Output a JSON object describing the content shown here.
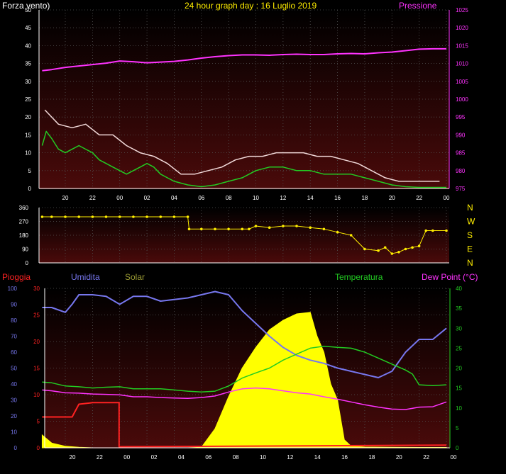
{
  "title": "24 hour graph day : 16 Luglio 2019",
  "colors": {
    "wind": "#ffffff",
    "gust": "#f0d8d8",
    "avg_wind": "#22cc22",
    "pressure": "#ff33ff",
    "direction": "#ffee00",
    "rain": "#ff2222",
    "humidity": "#7777ee",
    "solar": "#ffff00",
    "temperature": "#22cc22",
    "dewpoint": "#ff33ff",
    "axis": "#ffffff",
    "grid": "#555555"
  },
  "x_ticks": [
    "20",
    "22",
    "00",
    "02",
    "04",
    "06",
    "08",
    "10",
    "12",
    "14",
    "16",
    "18",
    "20",
    "22",
    "00"
  ],
  "chart_data": [
    {
      "type": "line",
      "title": "24 hour graph day : 16 Luglio 2019",
      "left_label": "Forza vento)",
      "right_label": "Pressione",
      "left_ticks": [
        "50",
        "45",
        "40",
        "35",
        "30",
        "25",
        "20",
        "15",
        "10",
        "5",
        "0"
      ],
      "right_ticks": [
        "1025",
        "1020",
        "1015",
        "1010",
        "1005",
        "1000",
        "995",
        "990",
        "985",
        "980",
        "975"
      ],
      "ylim": [
        0,
        50
      ],
      "ylim_right": [
        975,
        1025
      ],
      "series": [
        {
          "key": "wind",
          "x": [
            18.5,
            19.5,
            20.5,
            21.5,
            22.5,
            23.5,
            0.5,
            1.5,
            2.5,
            3.5,
            4.5,
            5.5,
            6.5,
            7.5,
            8.5,
            9.5,
            10.5,
            11.5,
            12.5,
            13.5,
            14.5,
            15.5,
            16.5,
            17.5,
            18.5,
            19.5,
            20.5,
            21.5,
            22.5,
            23.5
          ],
          "values": [
            22,
            18,
            17,
            18,
            15,
            15,
            12,
            10,
            9,
            7,
            4,
            4,
            5,
            6,
            8,
            9,
            9,
            10,
            10,
            10,
            9,
            9,
            8,
            7,
            5,
            3,
            2,
            2,
            2,
            2
          ]
        },
        {
          "key": "avg_wind",
          "x": [
            18.3,
            18.6,
            19.0,
            19.5,
            20.0,
            20.5,
            21.0,
            21.5,
            22.0,
            22.5,
            23.0,
            23.5,
            0.0,
            0.5,
            1.0,
            1.5,
            2.0,
            2.5,
            3.0,
            3.5,
            4.0,
            5.0,
            6.0,
            7.0,
            8.0,
            9.0,
            10.0,
            11.0,
            12.0,
            13.0,
            14.0,
            15.0,
            16.0,
            17.0,
            18.0,
            19.0,
            20.0,
            21.0,
            22.0,
            23.0,
            24.0
          ],
          "values": [
            12,
            16,
            14,
            11,
            10,
            11,
            12,
            11,
            10,
            8,
            7,
            6,
            5,
            4,
            5,
            6,
            7,
            6,
            4,
            3,
            2,
            1,
            0.5,
            1,
            2,
            3,
            5,
            6,
            6,
            5,
            5,
            4,
            4,
            4,
            3,
            2,
            1,
            0.5,
            0.3,
            0.3,
            0.3
          ]
        },
        {
          "key": "pressure",
          "x": [
            18.3,
            19.0,
            20.0,
            21.0,
            22.0,
            23.0,
            0.0,
            1.0,
            2.0,
            3.0,
            4.0,
            5.0,
            6.0,
            7.0,
            8.0,
            9.0,
            10.0,
            11.0,
            12.0,
            13.0,
            14.0,
            15.0,
            16.0,
            17.0,
            18.0,
            19.0,
            20.0,
            21.0,
            22.0,
            23.0,
            24.0
          ],
          "values": [
            1008.0,
            1008.3,
            1008.9,
            1009.3,
            1009.7,
            1010.1,
            1010.7,
            1010.5,
            1010.2,
            1010.4,
            1010.6,
            1011.0,
            1011.5,
            1011.9,
            1012.2,
            1012.4,
            1012.4,
            1012.3,
            1012.5,
            1012.6,
            1012.5,
            1012.5,
            1012.7,
            1012.8,
            1012.7,
            1013.0,
            1013.2,
            1013.6,
            1014.0,
            1014.1,
            1014.1
          ]
        }
      ]
    },
    {
      "type": "scatter",
      "left_ticks": [
        "360",
        "270",
        "180",
        "90",
        "0"
      ],
      "right_ticks": [
        "N",
        "W",
        "S",
        "E",
        "N"
      ],
      "ylim": [
        0,
        360
      ],
      "series": [
        {
          "key": "direction",
          "x": [
            18.3,
            19.0,
            20.0,
            21.0,
            22.0,
            23.0,
            0.0,
            1.0,
            2.0,
            3.0,
            4.0,
            5.0,
            5.1,
            6.0,
            7.0,
            8.0,
            9.0,
            9.5,
            10.0,
            11.0,
            12.0,
            13.0,
            14.0,
            15.0,
            16.0,
            17.0,
            18.0,
            19.0,
            19.5,
            20.0,
            20.5,
            21.0,
            21.5,
            22.0,
            22.5,
            23.0,
            24.0
          ],
          "values": [
            300,
            300,
            300,
            300,
            300,
            300,
            300,
            300,
            300,
            300,
            300,
            300,
            220,
            220,
            220,
            220,
            220,
            220,
            240,
            230,
            240,
            240,
            230,
            220,
            200,
            180,
            90,
            80,
            100,
            60,
            70,
            90,
            100,
            110,
            210,
            210,
            210
          ]
        }
      ]
    },
    {
      "type": "line",
      "labels": [
        "Pioggia",
        "Umidita",
        "Solar",
        "Temperatura",
        "Dew Point (°C)"
      ],
      "left_ticks_rain": [
        "30",
        "25",
        "20",
        "15",
        "10",
        "5",
        "0"
      ],
      "left_ticks_hum": [
        "100",
        "90",
        "80",
        "70",
        "60",
        "50",
        "40",
        "30",
        "20",
        "10",
        "0"
      ],
      "right_ticks": [
        "40",
        "35",
        "30",
        "25",
        "20",
        "15",
        "10",
        "5",
        "0"
      ],
      "ylim_rain": [
        0,
        30
      ],
      "ylim_humidity": [
        0,
        100
      ],
      "ylim_temp": [
        0,
        40
      ],
      "series": [
        {
          "key": "rain",
          "x": [
            18.3,
            19.5,
            20.5,
            21.0,
            22.0,
            23.0,
            23.95,
            23.95,
            24.0,
            48.0
          ],
          "values": [
            5.8,
            5.8,
            5.8,
            8.2,
            8.5,
            8.5,
            8.5,
            0.2,
            0.2,
            0.5
          ]
        },
        {
          "key": "humidity",
          "x": [
            18.3,
            19.0,
            20.0,
            20.5,
            21.0,
            22.0,
            23.0,
            0.0,
            1.0,
            2.0,
            3.0,
            4.0,
            5.0,
            6.0,
            7.0,
            8.0,
            9.0,
            10.0,
            11.0,
            12.0,
            13.0,
            14.0,
            15.0,
            16.0,
            17.0,
            18.0,
            19.0,
            20.0,
            21.0,
            22.0,
            23.0,
            24.0
          ],
          "values": [
            88,
            88,
            85,
            90,
            96,
            96,
            95,
            90,
            95,
            95,
            92,
            93,
            94,
            96,
            98,
            96,
            86,
            78,
            70,
            63,
            58,
            55,
            53,
            50,
            48,
            46,
            44,
            48,
            60,
            68,
            68,
            75
          ]
        },
        {
          "key": "solar",
          "x": [
            18.3,
            19.0,
            20.0,
            21.0,
            22.0,
            23.0,
            0.0,
            1.0,
            2.0,
            3.0,
            4.0,
            5.0,
            6.0,
            7.0,
            8.0,
            9.0,
            10.0,
            11.0,
            12.0,
            13.0,
            14.0,
            14.5,
            15.0,
            15.5,
            16.0,
            16.5,
            17.0,
            18.0,
            20.0,
            22.0,
            24.0
          ],
          "values": [
            8,
            3,
            1,
            0.3,
            0,
            0,
            0,
            0,
            0,
            0,
            0,
            0,
            0.3,
            12,
            32,
            50,
            63,
            74,
            80,
            84,
            85,
            70,
            60,
            40,
            30,
            5,
            1,
            0.5,
            0.3,
            0.2,
            0.2
          ]
        },
        {
          "key": "temperature",
          "x": [
            18.3,
            19.0,
            20.0,
            21.0,
            22.0,
            23.0,
            0.0,
            1.0,
            2.0,
            3.0,
            4.0,
            5.0,
            6.0,
            7.0,
            8.0,
            9.0,
            10.0,
            11.0,
            12.0,
            13.0,
            14.0,
            15.0,
            16.0,
            17.0,
            18.0,
            19.0,
            20.0,
            21.0,
            21.5,
            22.0,
            23.0,
            24.0
          ],
          "values": [
            16.5,
            16.3,
            15.5,
            15.3,
            15.0,
            15.2,
            15.3,
            14.8,
            14.8,
            14.8,
            14.5,
            14.2,
            14.0,
            14.2,
            15.5,
            17.5,
            18.8,
            20.0,
            22.0,
            23.5,
            25.0,
            25.5,
            25.2,
            25.0,
            24.0,
            22.5,
            21.0,
            19.5,
            18.5,
            15.8,
            15.6,
            15.8
          ]
        },
        {
          "key": "dewpoint",
          "x": [
            18.3,
            19.0,
            20.0,
            21.0,
            22.0,
            23.0,
            0.0,
            1.0,
            2.0,
            3.0,
            4.0,
            5.0,
            6.0,
            7.0,
            8.0,
            9.0,
            10.0,
            11.0,
            12.0,
            13.0,
            14.0,
            15.0,
            16.0,
            17.0,
            18.0,
            19.0,
            20.0,
            21.0,
            22.0,
            23.0,
            24.0
          ],
          "values": [
            14.5,
            14.3,
            13.8,
            13.7,
            13.5,
            13.4,
            13.3,
            12.8,
            12.8,
            12.6,
            12.5,
            12.4,
            12.6,
            13.0,
            14.0,
            14.8,
            15.0,
            14.8,
            14.3,
            13.8,
            13.5,
            12.8,
            12.2,
            11.5,
            10.8,
            10.2,
            9.7,
            9.6,
            10.2,
            10.3,
            11.5
          ]
        }
      ]
    }
  ]
}
